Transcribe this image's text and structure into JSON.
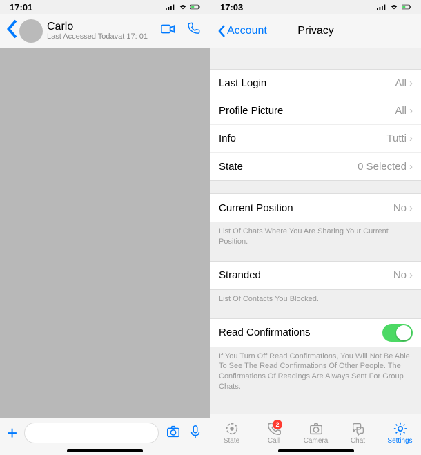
{
  "left": {
    "status_time": "17:01",
    "header": {
      "title": "Carlo",
      "subtitle": "Last Accessed Todavat 17: 01"
    },
    "input": {
      "placeholder": ""
    }
  },
  "right": {
    "status_time": "17:03",
    "nav": {
      "back": "Account",
      "title": "Privacy"
    },
    "sections": {
      "s1": {
        "r0": {
          "label": "Last Login",
          "value": "All"
        },
        "r1": {
          "label": "Profile Picture",
          "value": "All"
        },
        "r2": {
          "label": "Info",
          "value": "Tutti"
        },
        "r3": {
          "label": "State",
          "value": "0 Selected"
        }
      },
      "s2": {
        "r0": {
          "label": "Current Position",
          "value": "No"
        },
        "caption": "List Of Chats Where You Are Sharing Your Current Position."
      },
      "s3": {
        "r0": {
          "label": "Stranded",
          "value": "No"
        },
        "caption": "List Of Contacts You Blocked."
      },
      "s4": {
        "r0": {
          "label": "Read Confirmations"
        },
        "caption": "If You Turn Off Read Confirmations, You Will Not Be Able To See The Read Confirmations Of Other People. The Confirmations Of Readings Are Always Sent For Group Chats."
      }
    },
    "tabs": {
      "t0": "State",
      "t1": "Call",
      "t1_badge": "2",
      "t2": "Camera",
      "t3": "Chat",
      "t4": "Settings"
    }
  }
}
